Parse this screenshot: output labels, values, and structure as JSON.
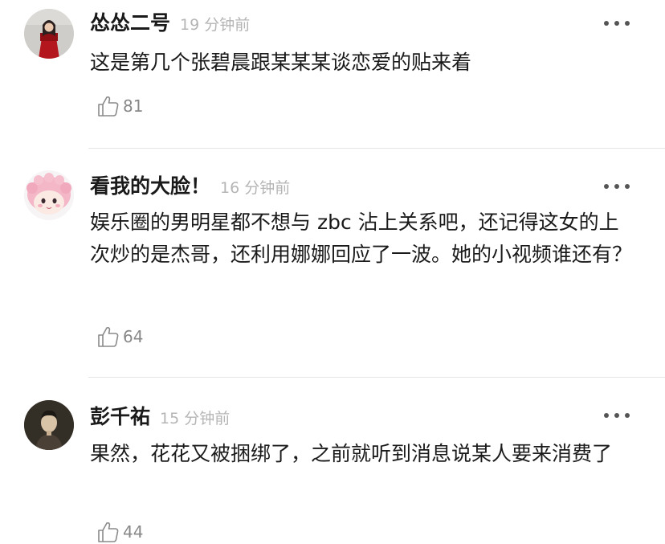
{
  "comments": [
    {
      "user": "怂怂二号",
      "time": "19 分钟前",
      "text": "这是第几个张碧晨跟某某某谈恋爱的贴来着",
      "likes": "81",
      "avatar_icon": "avatar-photo-red-dress",
      "avatar_colors": [
        "#c8c6c2",
        "#b3161c",
        "#2a2020"
      ]
    },
    {
      "user": "看我的大脸！",
      "time": "16 分钟前",
      "text": "娱乐圈的男明星都不想与 zbc 沾上关系吧，还记得这女的上次炒的是杰哥，还利用娜娜回应了一波。她的小视频谁还有？",
      "likes": "64",
      "avatar_icon": "avatar-cartoon-pink-hair",
      "avatar_colors": [
        "#f6f3f4",
        "#f3b7c8",
        "#e88aa5"
      ]
    },
    {
      "user": "彭千祐",
      "time": "15 分钟前",
      "text": "果然，花花又被捆绑了，之前就听到消息说某人要来消费了",
      "likes": "44",
      "avatar_icon": "avatar-photo-dark",
      "avatar_colors": [
        "#2a2620",
        "#d9c4a8",
        "#4a4036"
      ]
    }
  ],
  "icons": {
    "like": "thumbs-up-icon",
    "more": "more-dots-icon"
  }
}
